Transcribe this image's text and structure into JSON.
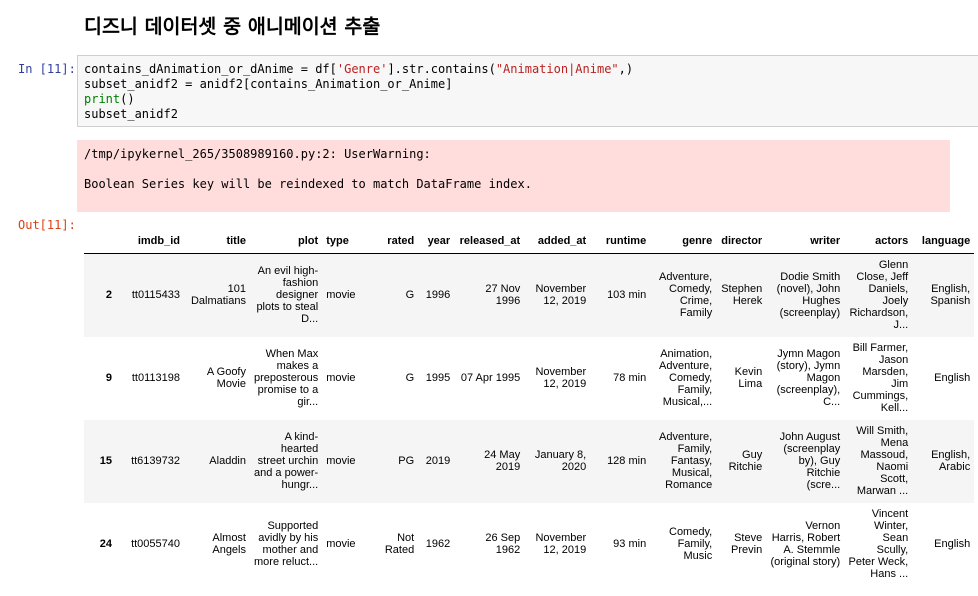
{
  "heading": "디즈니 데이터셋 중 애니메이션 추출",
  "in_prompt": "In [11]:",
  "out_prompt": "Out[11]:",
  "code": {
    "line1_a": "contains_dAnimation_or_dAnime = df[",
    "line1_s1": "'Genre'",
    "line1_b": "].str.contains(",
    "line1_s2": "\"Animation|Anime\"",
    "line1_c": ",)",
    "line2": "subset_anidf2 = anidf2[contains_Animation_or_Anime]",
    "line3_kw": "print",
    "line3_b": "()",
    "line4": "subset_anidf2"
  },
  "warning": {
    "line1": "/tmp/ipykernel_265/3508989160.py:2: UserWarning:",
    "line2": "Boolean Series key will be reindexed to match DataFrame index."
  },
  "table": {
    "columns": [
      "",
      "imdb_id",
      "title",
      "plot",
      "type",
      "rated",
      "year",
      "released_at",
      "added_at",
      "runtime",
      "genre",
      "director",
      "writer",
      "actors",
      "language"
    ],
    "rows": [
      {
        "idx": "2",
        "imdb_id": "tt0115433",
        "title": "101 Dalmatians",
        "plot": "An evil high-fashion designer plots to steal D...",
        "type": "movie",
        "rated": "G",
        "year": "1996",
        "released_at": "27 Nov 1996",
        "added_at": "November 12, 2019",
        "runtime": "103 min",
        "genre": "Adventure, Comedy, Crime, Family",
        "director": "Stephen Herek",
        "writer": "Dodie Smith (novel), John Hughes (screenplay)",
        "actors": "Glenn Close, Jeff Daniels, Joely Richardson, J...",
        "language": "English, Spanish"
      },
      {
        "idx": "9",
        "imdb_id": "tt0113198",
        "title": "A Goofy Movie",
        "plot": "When Max makes a preposterous promise to a gir...",
        "type": "movie",
        "rated": "G",
        "year": "1995",
        "released_at": "07 Apr 1995",
        "added_at": "November 12, 2019",
        "runtime": "78 min",
        "genre": "Animation, Adventure, Comedy, Family, Musical,...",
        "director": "Kevin Lima",
        "writer": "Jymn Magon (story), Jymn Magon (screenplay), C...",
        "actors": "Bill Farmer, Jason Marsden, Jim Cummings, Kell...",
        "language": "English"
      },
      {
        "idx": "15",
        "imdb_id": "tt6139732",
        "title": "Aladdin",
        "plot": "A kind-hearted street urchin and a power-hungr...",
        "type": "movie",
        "rated": "PG",
        "year": "2019",
        "released_at": "24 May 2019",
        "added_at": "January 8, 2020",
        "runtime": "128 min",
        "genre": "Adventure, Family, Fantasy, Musical, Romance",
        "director": "Guy Ritchie",
        "writer": "John August (screenplay by), Guy Ritchie (scre...",
        "actors": "Will Smith, Mena Massoud, Naomi Scott, Marwan ...",
        "language": "English, Arabic"
      },
      {
        "idx": "24",
        "imdb_id": "tt0055740",
        "title": "Almost Angels",
        "plot": "Supported avidly by his mother and more reluct...",
        "type": "movie",
        "rated": "Not Rated",
        "year": "1962",
        "released_at": "26 Sep 1962",
        "added_at": "November 12, 2019",
        "runtime": "93 min",
        "genre": "Comedy, Family, Music",
        "director": "Steve Previn",
        "writer": "Vernon Harris, Robert A. Stemmle (original story)",
        "actors": "Vincent Winter, Sean Scully, Peter Weck, Hans ...",
        "language": "English"
      }
    ]
  }
}
